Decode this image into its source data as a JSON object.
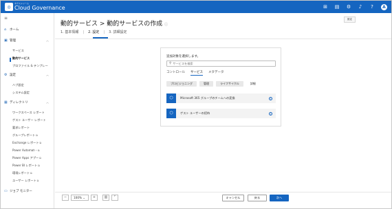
{
  "app": {
    "logo_sub": "ネクストリーム",
    "logo_name": "Cloud Governance"
  },
  "topbar": {
    "icons": [
      "grid-icon",
      "document-icon",
      "gear-icon",
      "bell-icon",
      "help-icon",
      "avatar"
    ],
    "help": "?",
    "avatar": "A"
  },
  "tooltip": "設定",
  "sidebar": {
    "home": "ホーム",
    "manage": "管理",
    "manage_items": [
      "サービス",
      "動的サービス",
      "プロファイル & テンプレー"
    ],
    "settings": "設定",
    "settings_items": [
      "ハブ設定",
      "システム設定"
    ],
    "directory": "ディレクトリ",
    "directory_items": [
      "ワークスペース レポート",
      "ゲスト ユーザー レポート",
      "要求レポート",
      "グループレポート",
      "Exchange レポート",
      "Power Automat···",
      "Power Apps アプー",
      "Power BI レポート",
      "環境レポート",
      "ユーザー レポート"
    ],
    "job_monitor": "ジョブ モニター"
  },
  "page": {
    "title": "動的サービス > 動的サービスの作成",
    "steps": [
      "1. 基本情報",
      "2. 設定",
      "3. 詳細設定"
    ],
    "separator": "|"
  },
  "panel": {
    "heading": "追加対象を選択します。",
    "search_placeholder": "サービスを検索",
    "tabs": [
      "コントロール",
      "サービス",
      "メタデータ"
    ],
    "pills": [
      "プロビジョニング",
      "管理",
      "ライフサイクル",
      "詳細"
    ],
    "services": [
      "Microsoft 365 グループのチームへの変換",
      "ゲスト ユーザーの招待"
    ]
  },
  "footer": {
    "zoom_minus": "−",
    "zoom_value": "100%",
    "zoom_plus": "+",
    "cancel": "キャンセル",
    "back": "戻る",
    "next": "次へ"
  },
  "colors": {
    "accent": "#1565c0"
  }
}
